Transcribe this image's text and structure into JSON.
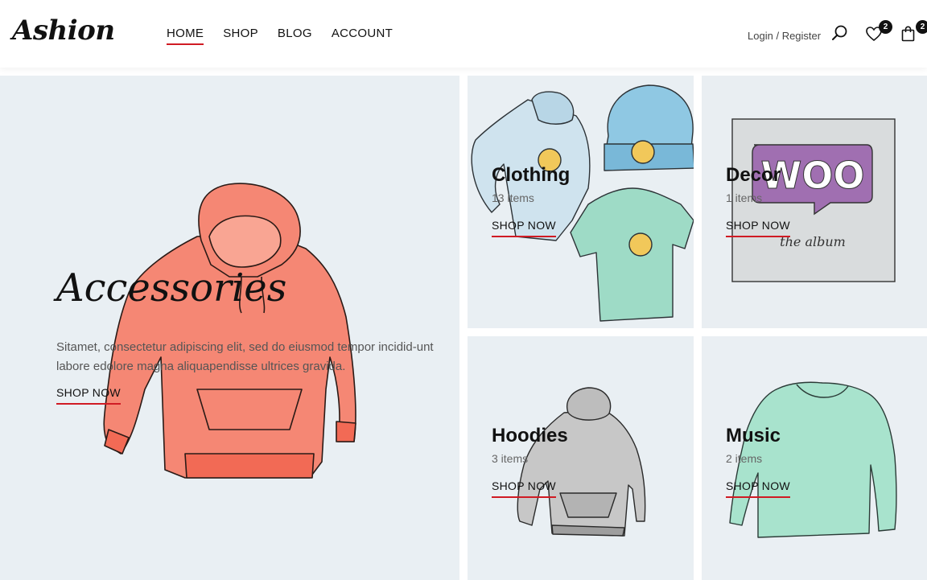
{
  "header": {
    "logo": "Ashion",
    "nav": [
      {
        "label": "HOME",
        "active": true
      },
      {
        "label": "SHOP",
        "active": false
      },
      {
        "label": "BLOG",
        "active": false
      },
      {
        "label": "ACCOUNT",
        "active": false
      }
    ],
    "login": "Login",
    "separator": "/",
    "register": "Register",
    "wishlist_count": "2",
    "cart_count": "2",
    "accent_color": "#d01b24"
  },
  "hero": {
    "title": "Accessories",
    "description": "Sitamet, consectetur adipiscing elit, sed do eiusmod tempor incidid-unt labore edolore magna aliquapendisse ultrices gravida.",
    "cta": "SHOP NOW"
  },
  "categories": [
    {
      "title": "Clothing",
      "count": "13 items",
      "cta": "SHOP NOW"
    },
    {
      "title": "Decor",
      "count": "1 items",
      "cta": "SHOP NOW"
    },
    {
      "title": "Hoodies",
      "count": "3 items",
      "cta": "SHOP NOW"
    },
    {
      "title": "Music",
      "count": "2 items",
      "cta": "SHOP NOW"
    }
  ],
  "decor_art": {
    "word": "WOO",
    "caption": "the album"
  }
}
